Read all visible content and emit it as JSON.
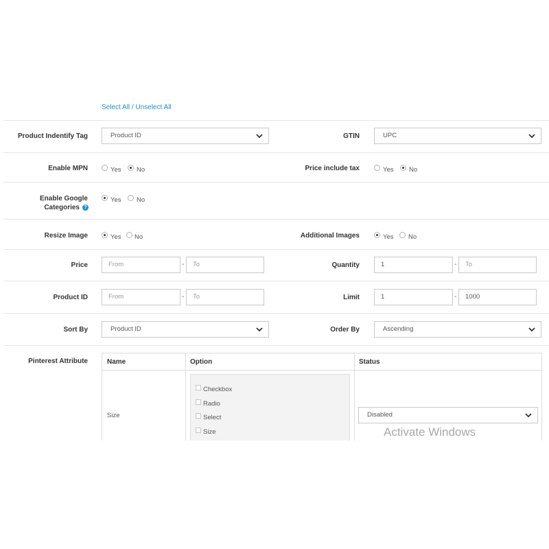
{
  "select_links": "Select All / Unselect All",
  "rows": {
    "identify_tag": {
      "label": "Product Indentify Tag",
      "value": "Product ID"
    },
    "gtin": {
      "label": "GTIN",
      "value": "UPC"
    },
    "enable_mpn": {
      "label": "Enable MPN",
      "yes": "Yes",
      "no": "No",
      "selected": "No"
    },
    "price_tax": {
      "label": "Price include tax",
      "yes": "Yes",
      "no": "No",
      "selected": "No"
    },
    "google_categories": {
      "label_line1": "Enable Google",
      "label_line2": "Categories",
      "help_icon": "question-icon",
      "yes": "Yes",
      "no": "No",
      "selected": "Yes"
    },
    "resize_image": {
      "label": "Resize Image",
      "yes": "Yes",
      "no": "No",
      "selected": "Yes"
    },
    "additional_images": {
      "label": "Additional Images",
      "yes": "Yes",
      "no": "No",
      "selected": "Yes"
    },
    "price": {
      "label": "Price",
      "from_placeholder": "From",
      "to_placeholder": "To",
      "separator": "-"
    },
    "quantity": {
      "label": "Quantity",
      "from_value": "1",
      "to_placeholder": "To",
      "separator": "-"
    },
    "product_id": {
      "label": "Product ID",
      "from_placeholder": "From",
      "to_placeholder": "To",
      "separator": "-"
    },
    "limit": {
      "label": "Limit",
      "from_value": "1",
      "to_value": "1000",
      "separator": "-"
    },
    "sort_by": {
      "label": "Sort By",
      "value": "Product ID"
    },
    "order_by": {
      "label": "Order By",
      "value": "Ascending"
    }
  },
  "pinterest": {
    "label": "Pinterest Attribute",
    "headers": [
      "Name",
      "Option",
      "Status"
    ],
    "row": {
      "name": "Size",
      "options": [
        "Checkbox",
        "Radio",
        "Select",
        "Size"
      ],
      "status": "Disabled"
    }
  },
  "watermark": "Activate Windows",
  "colors": {
    "link": "#1e91cf",
    "border": "#c8c8c8"
  }
}
